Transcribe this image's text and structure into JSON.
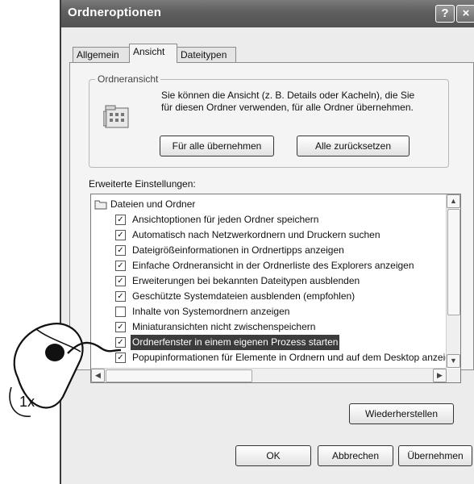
{
  "window": {
    "title": "Ordneroptionen",
    "help_glyph": "?",
    "close_glyph": "×"
  },
  "tabs": [
    {
      "label": "Allgemein",
      "active": false
    },
    {
      "label": "Ansicht",
      "active": true
    },
    {
      "label": "Dateitypen",
      "active": false
    }
  ],
  "folder_view": {
    "group_label": "Ordneransicht",
    "description": "Sie können die Ansicht (z. B. Details oder Kacheln), die Sie für diesen Ordner verwenden, für alle Ordner übernehmen.",
    "apply_all_label": "Für alle übernehmen",
    "reset_all_label": "Alle zurücksetzen"
  },
  "advanced": {
    "label": "Erweiterte Einstellungen:",
    "root_label": "Dateien und Ordner",
    "items": [
      {
        "label": "Ansichtoptionen für jeden Ordner speichern",
        "checked": true
      },
      {
        "label": "Automatisch nach Netzwerkordnern und Druckern suchen",
        "checked": true
      },
      {
        "label": "Dateigrößeinformationen in Ordnertipps anzeigen",
        "checked": true
      },
      {
        "label": "Einfache Ordneransicht in der Ordnerliste des Explorers anzeigen",
        "checked": true
      },
      {
        "label": "Erweiterungen bei bekannten Dateitypen ausblenden",
        "checked": true
      },
      {
        "label": "Geschützte Systemdateien ausblenden (empfohlen)",
        "checked": true
      },
      {
        "label": "Inhalte von Systemordnern anzeigen",
        "checked": false
      },
      {
        "label": "Miniaturansichten nicht zwischenspeichern",
        "checked": true
      },
      {
        "label": "Ordnerfenster in einem eigenen Prozess starten",
        "checked": true,
        "selected": true
      },
      {
        "label": "Popupinformationen für Elemente in Ordnern und auf dem Desktop anzeigen",
        "checked": true
      }
    ]
  },
  "restore_label": "Wiederherstellen",
  "footer": {
    "ok_label": "OK",
    "cancel_label": "Abbrechen",
    "apply_label": "Übernehmen"
  },
  "annotation": {
    "click_count": "1x"
  }
}
